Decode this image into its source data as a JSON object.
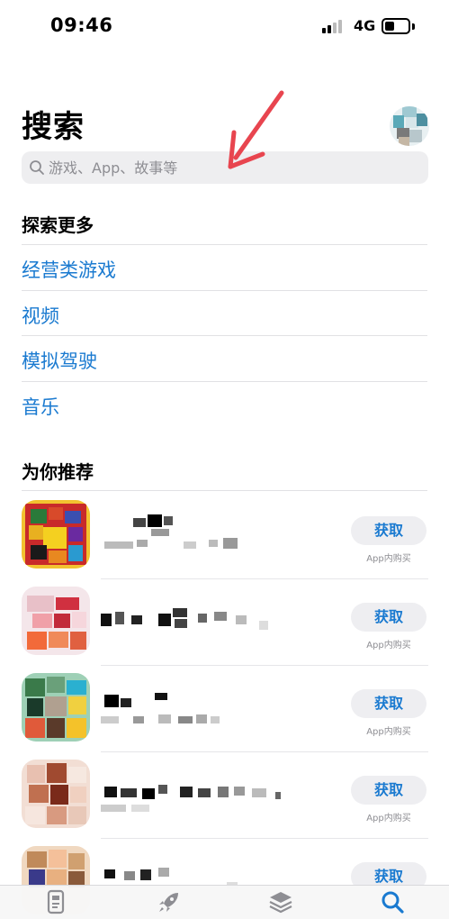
{
  "status_bar": {
    "time": "09:46",
    "network": "4G",
    "battery_level": 0.4
  },
  "header": {
    "title": "搜索",
    "avatar_icon": "account-avatar"
  },
  "search": {
    "placeholder": "游戏、App、故事等",
    "icon": "search-icon"
  },
  "explore": {
    "title": "探索更多",
    "links": [
      "经营类游戏",
      "视频",
      "模拟驾驶",
      "音乐"
    ]
  },
  "recommend": {
    "title": "为你推荐",
    "apps": [
      {
        "get_label": "获取",
        "iap_note": "App内购买"
      },
      {
        "get_label": "获取",
        "iap_note": "App内购买"
      },
      {
        "get_label": "获取",
        "iap_note": "App内购买"
      },
      {
        "get_label": "获取",
        "iap_note": "App内购买"
      },
      {
        "get_label": "获取",
        "iap_note": ""
      }
    ]
  },
  "tab_bar": {
    "tabs": [
      {
        "icon": "today-icon"
      },
      {
        "icon": "rocket-icon"
      },
      {
        "icon": "apps-stack-icon"
      },
      {
        "icon": "search-tab-icon",
        "selected": true
      }
    ]
  },
  "colors": {
    "accent": "#1a7ad0",
    "annotation": "#e8454f"
  }
}
